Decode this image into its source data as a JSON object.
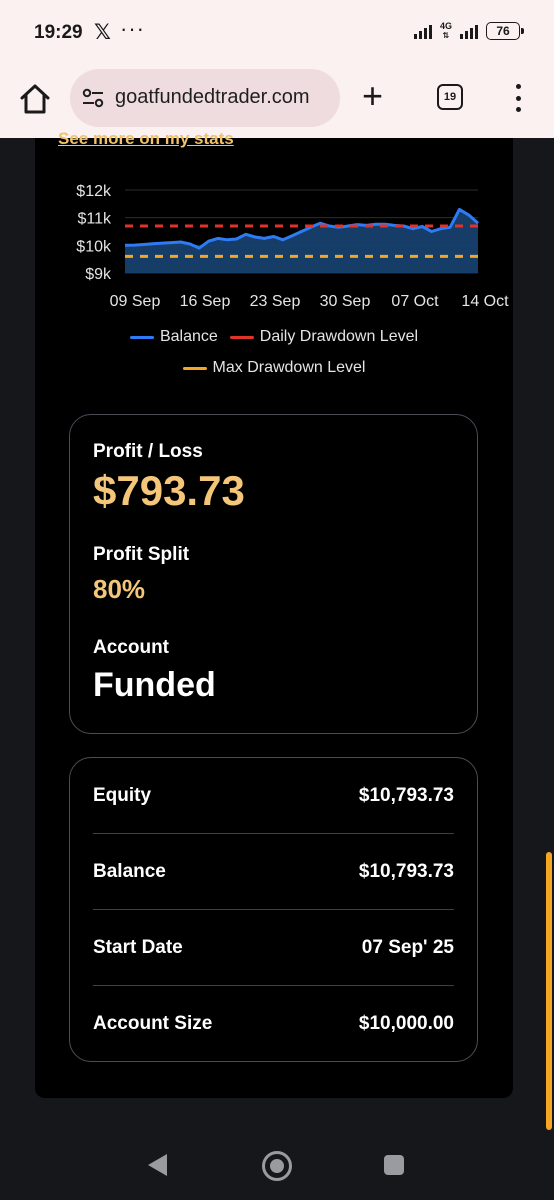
{
  "status_bar": {
    "time": "19:29",
    "app_icon": "x-icon",
    "more": "···",
    "network": "4G",
    "battery": "76"
  },
  "browser": {
    "url": "goatfundedtrader.com",
    "tab_count": "19"
  },
  "panel": {
    "see_more_link": "See more on my stats"
  },
  "chart_data": {
    "type": "line",
    "y_ticks": [
      "$12k",
      "$11k",
      "$10k",
      "$9k"
    ],
    "ylim": [
      9000,
      12000
    ],
    "x_ticks": [
      "09 Sep",
      "16 Sep",
      "23 Sep",
      "30 Sep",
      "07 Oct",
      "14 Oct"
    ],
    "series": [
      {
        "name": "Balance",
        "color": "#2f7bf5",
        "x": [
          "09 Sep",
          "10 Sep",
          "11 Sep",
          "12 Sep",
          "13 Sep",
          "14 Sep",
          "15 Sep",
          "16 Sep",
          "17 Sep",
          "18 Sep",
          "19 Sep",
          "20 Sep",
          "21 Sep",
          "22 Sep",
          "23 Sep",
          "24 Sep",
          "25 Sep",
          "26 Sep",
          "27 Sep",
          "28 Sep",
          "29 Sep",
          "30 Sep",
          "01 Oct",
          "02 Oct",
          "03 Oct",
          "04 Oct",
          "05 Oct",
          "06 Oct",
          "07 Oct",
          "08 Oct",
          "09 Oct",
          "10 Oct",
          "11 Oct",
          "12 Oct",
          "13 Oct",
          "14 Oct",
          "15 Oct",
          "16 Oct",
          "17 Oct"
        ],
        "values": [
          10000,
          10010,
          10030,
          10060,
          10080,
          10100,
          10120,
          10050,
          9900,
          10150,
          10250,
          10200,
          10230,
          10400,
          10300,
          10250,
          10320,
          10200,
          10350,
          10500,
          10650,
          10800,
          10700,
          10650,
          10700,
          10750,
          10720,
          10760,
          10760,
          10720,
          10700,
          10600,
          10680,
          10500,
          10600,
          10650,
          11300,
          11100,
          10800
        ]
      },
      {
        "name": "Daily Drawdown Level",
        "color": "#e0342b",
        "values": [
          10700
        ]
      },
      {
        "name": "Max Drawdown Level",
        "color": "#f5a623",
        "values": [
          9600
        ]
      }
    ]
  },
  "stats": {
    "profit_loss_label": "Profit / Loss",
    "profit_loss_value": "$793.73",
    "profit_split_label": "Profit Split",
    "profit_split_value": "80%",
    "account_label": "Account",
    "account_value": "Funded"
  },
  "details": [
    {
      "label": "Equity",
      "value": "$10,793.73"
    },
    {
      "label": "Balance",
      "value": "$10,793.73"
    },
    {
      "label": "Start Date",
      "value": "07 Sep' 25"
    },
    {
      "label": "Account Size",
      "value": "$10,000.00"
    }
  ]
}
